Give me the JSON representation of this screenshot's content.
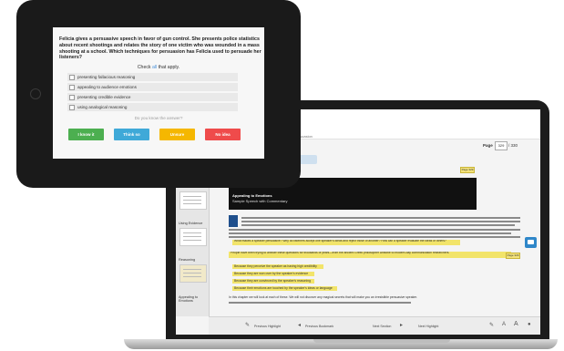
{
  "tablet": {
    "question": "Felicia gives a persuasive speech in favor of gun control. She presents police statistics about recent shootings and relates the story of one victim who was wounded in a mass shooting at a school. Which techniques for persuasion has Felicia used to persuade her listeners?",
    "check_prefix": "Check ",
    "check_all": "all",
    "check_suffix": " that apply.",
    "options": [
      "presenting fallacious reasoning",
      "appealing to audience emotions",
      "presenting credible evidence",
      "using analogical reasoning"
    ],
    "know_prompt": "Do you know the answer?",
    "buttons": [
      {
        "label": "I know it",
        "color": "#4caf50"
      },
      {
        "label": "Think so",
        "color": "#3fa9d8"
      },
      {
        "label": "Unsure",
        "color": "#f5b700"
      },
      {
        "label": "No idea",
        "color": "#ef4b4b"
      }
    ]
  },
  "laptop": {
    "breadcrumb": "< of Persuasion",
    "page_label": "Page",
    "page_value": "329",
    "page_total": "/ 330",
    "page_tag": "Page 329",
    "banner_title": "Appealing to Emotions",
    "banner_sub": "Sample Speech with Commentary",
    "highlight_q": "What makes a speaker persuasive? Why do listeners accept one speaker's ideas and reject those of another? How can a speaker evaluate the ideas of others?",
    "highlight_p": "People have been trying to answer these questions for thousands of years—from the ancient Greek philosopher Aristotle to modern-day communication researchers.",
    "bullets": [
      "Because they perceive the speaker as having high credibility",
      "Because they are won over by the speaker's evidence",
      "Because they are convinced by the speaker's reasoning",
      "Because their emotions are touched by the speaker's ideas or language"
    ],
    "closing": "In this chapter we will look at each of these. We will not discover any magical secrets that will make you an irresistible persuasive speaker.",
    "sidebar_labels": [
      "Using Evidence",
      "Reasoning",
      "Appealing to Emotions"
    ],
    "nav": [
      "Previous Highlight",
      "Previous Bookmark",
      "Next Section",
      "Next Highlight"
    ]
  }
}
